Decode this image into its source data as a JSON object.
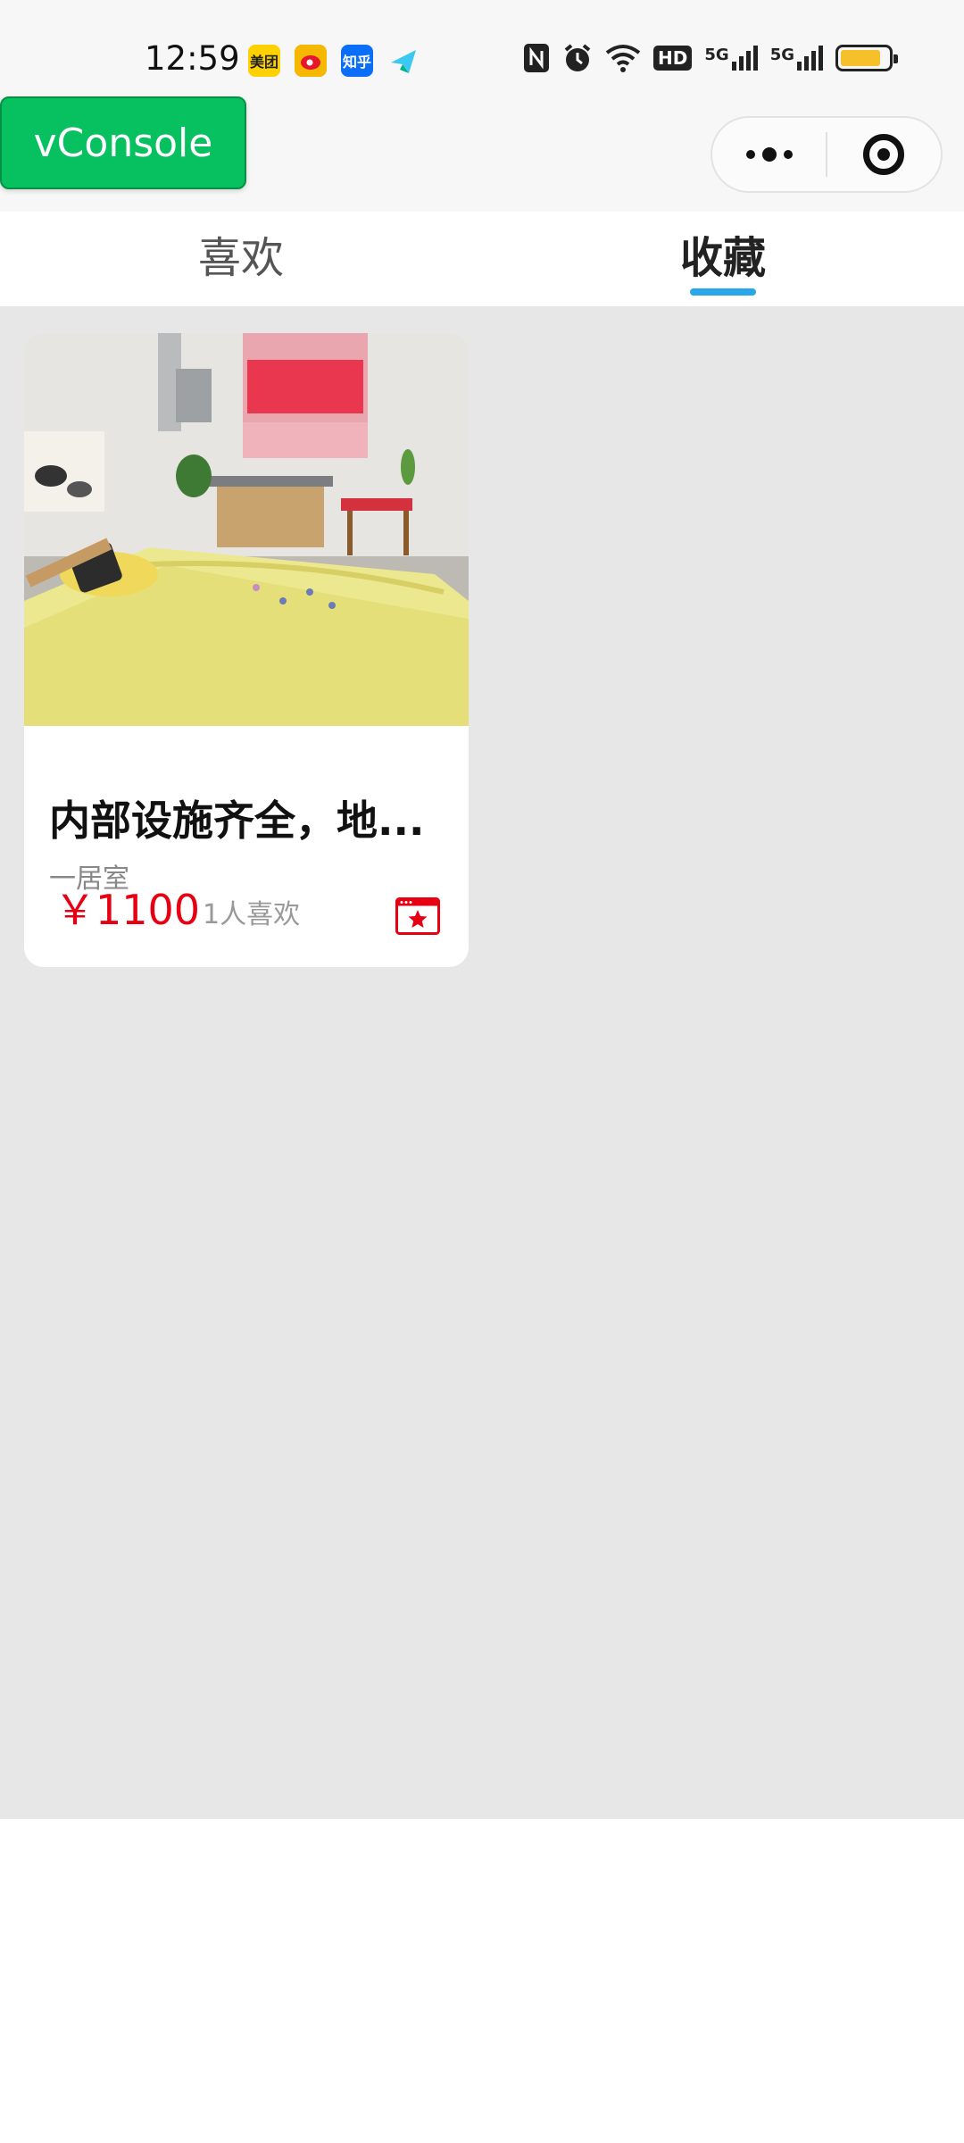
{
  "status_bar": {
    "time": "12:59",
    "app_icons": [
      {
        "name": "meituan-icon",
        "label": "美团",
        "color": "#ffd100"
      },
      {
        "name": "weibo-icon",
        "label": "",
        "color": "#f5b700"
      },
      {
        "name": "zhihu-icon",
        "label": "知乎",
        "color": "#0b6ef9"
      },
      {
        "name": "feishu-icon",
        "label": "",
        "color": "#3cc8f0"
      }
    ],
    "indicators": [
      "nfc-icon",
      "alarm-icon",
      "wifi-icon",
      "hd-icon",
      "5g-signal-icon",
      "5g-signal-icon",
      "battery-icon"
    ],
    "hd_label": "HD",
    "signal_label": "5G",
    "battery_level": 0.85,
    "battery_color": "#f5c02a"
  },
  "nav": {
    "title": "收藏",
    "title_visible": "藏"
  },
  "vconsole": {
    "label": "vConsole",
    "color": "#07c160"
  },
  "tabs": [
    {
      "label": "喜欢",
      "active": false
    },
    {
      "label": "收藏",
      "active": true
    }
  ],
  "accent_color": "#2aa7e8",
  "listing": {
    "title": "内部设施齐全，地...",
    "subtitle": "一居室",
    "price": "￥1100",
    "likes": "1人喜欢",
    "price_color": "#e60012"
  }
}
